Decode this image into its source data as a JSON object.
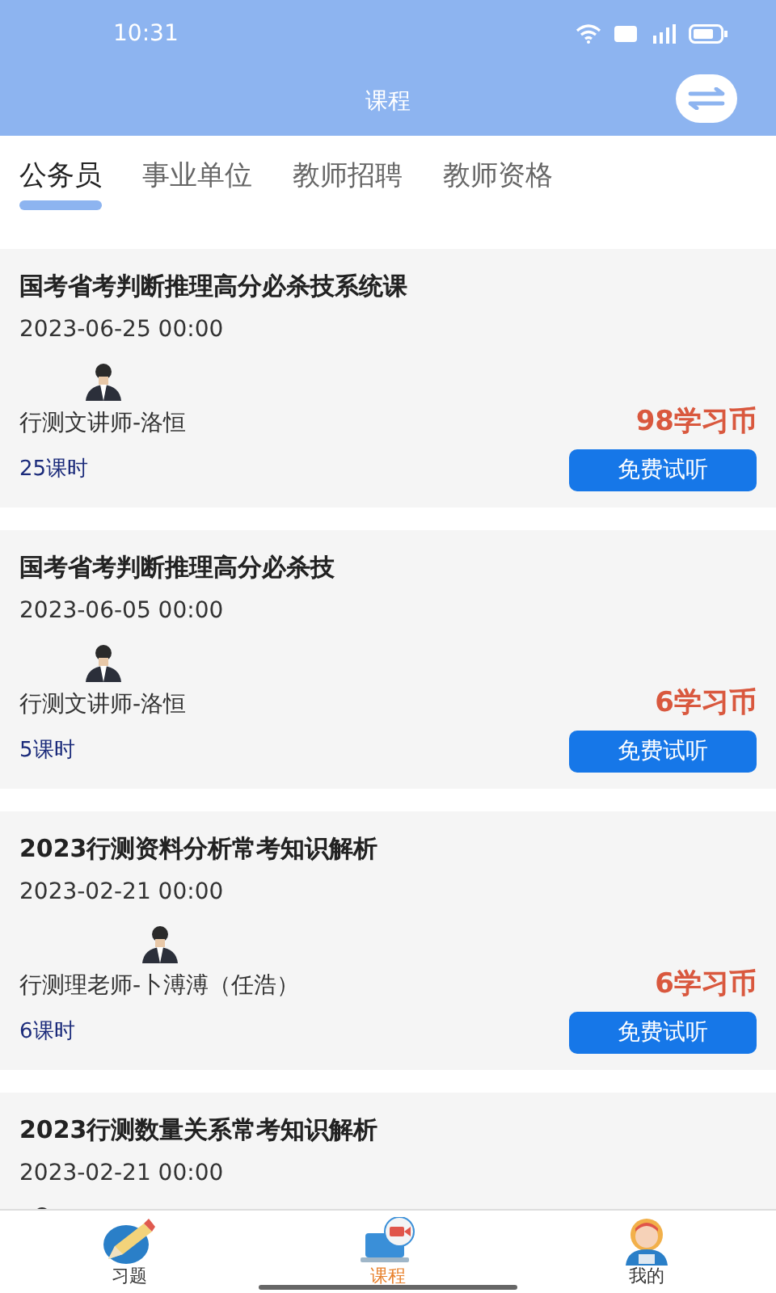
{
  "status_bar": {
    "time": "10:31"
  },
  "header": {
    "title": "课程"
  },
  "tabs": [
    {
      "label": "公务员",
      "selected": true
    },
    {
      "label": "事业单位",
      "selected": false
    },
    {
      "label": "教师招聘",
      "selected": false
    },
    {
      "label": "教师资格",
      "selected": false
    }
  ],
  "courses": [
    {
      "title": "国考省考判断推理高分必杀技系统课",
      "date": "2023-06-25 00:00",
      "teacher": "行测文讲师-洛恒",
      "price": "98学习币",
      "lessons": "25课时",
      "button": "免费试听"
    },
    {
      "title": "国考省考判断推理高分必杀技",
      "date": "2023-06-05 00:00",
      "teacher": "行测文讲师-洛恒",
      "price": "6学习币",
      "lessons": "5课时",
      "button": "免费试听"
    },
    {
      "title": "2023行测资料分析常考知识解析",
      "date": "2023-02-21 00:00",
      "teacher": "行测理老师-卜溥溥（任浩）",
      "price": "6学习币",
      "lessons": "6课时",
      "button": "免费试听"
    },
    {
      "title": "2023行测数量关系常考知识解析",
      "date": "2023-02-21 00:00"
    }
  ],
  "bottom_nav": [
    {
      "label": "习题",
      "kind": "pencil",
      "selected": false
    },
    {
      "label": "课程",
      "kind": "laptop",
      "selected": true
    },
    {
      "label": "我的",
      "kind": "person",
      "selected": false
    }
  ]
}
